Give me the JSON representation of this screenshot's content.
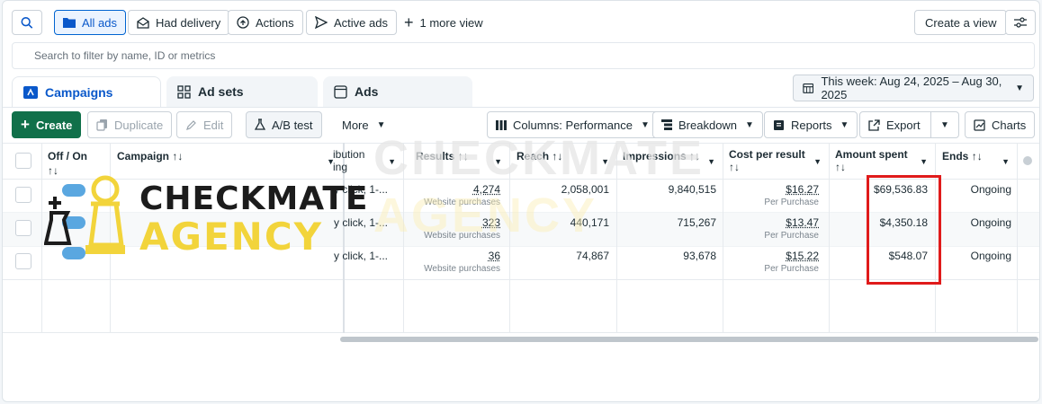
{
  "toolbar": {
    "views": [
      {
        "label": "All ads",
        "icon": "folder-icon"
      },
      {
        "label": "Had delivery",
        "icon": "mail-open-icon"
      },
      {
        "label": "Actions",
        "icon": "arrow-up-circle-icon"
      },
      {
        "label": "Active ads",
        "icon": "send-icon"
      },
      {
        "label": "1 more view",
        "icon": "plus-icon"
      }
    ],
    "create_view": "Create a view"
  },
  "search": {
    "placeholder": "Search to filter by name, ID or metrics"
  },
  "tabs": [
    "Campaigns",
    "Ad sets",
    "Ads"
  ],
  "date_range": "This week: Aug 24, 2025 – Aug 30, 2025",
  "actions": {
    "create": "Create",
    "duplicate": "Duplicate",
    "edit": "Edit",
    "ab_test": "A/B test",
    "more": "More",
    "columns": "Columns: Performance",
    "breakdown": "Breakdown",
    "reports": "Reports",
    "export": "Export",
    "charts": "Charts"
  },
  "table": {
    "headers": {
      "off_on": "Off / On",
      "campaign": "Campaign",
      "attribution_line1": "ibution",
      "attribution_line2": "ing",
      "results": "Results",
      "reach": "Reach",
      "impressions": "Impressions",
      "cost_per_result": "Cost per result",
      "amount_spent": "Amount spent",
      "ends": "Ends",
      "sort_marker": "↑↓"
    },
    "rows": [
      {
        "attribution": "y click, 1-...",
        "results": "4,274",
        "results_sub": "Website purchases",
        "reach": "2,058,001",
        "impressions": "9,840,515",
        "cost": "$16.27",
        "cost_sub": "Per Purchase",
        "amount": "$69,536.83",
        "ends": "Ongoing"
      },
      {
        "attribution": "y click, 1-...",
        "results": "323",
        "results_sub": "Website purchases",
        "reach": "440,171",
        "impressions": "715,267",
        "cost": "$13.47",
        "cost_sub": "Per Purchase",
        "amount": "$4,350.18",
        "ends": "Ongoing"
      },
      {
        "attribution": "y click, 1-...",
        "results": "36",
        "results_sub": "Website purchases",
        "reach": "74,867",
        "impressions": "93,678",
        "cost": "$15.22",
        "cost_sub": "Per Purchase",
        "amount": "$548.07",
        "ends": "Ongoing"
      }
    ]
  },
  "logo": {
    "line1": "CHECKMATE",
    "line2": "AGENCY"
  },
  "colors": {
    "accent": "#0a58ca",
    "create_green": "#10704a",
    "highlight_red": "#e01b1b",
    "logo_yellow": "#f2d43b"
  }
}
